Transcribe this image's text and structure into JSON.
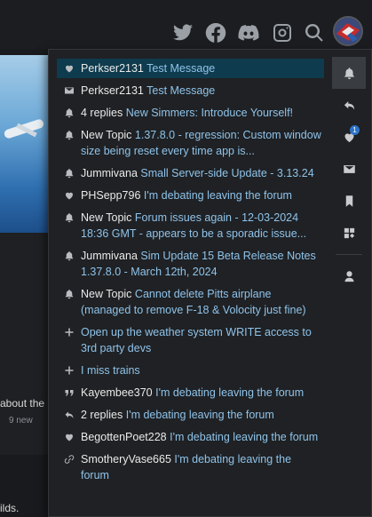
{
  "background": {
    "snippet": "about the",
    "meta": "9 new",
    "bottom_text": "ilds."
  },
  "header": {
    "icons": [
      "twitter-icon",
      "facebook-icon",
      "discord-icon",
      "instagram-icon",
      "search-icon"
    ]
  },
  "notifications": [
    {
      "icon": "heart-icon",
      "actor": "Perkser2131",
      "topic": "Test Message",
      "active": true
    },
    {
      "icon": "envelope-icon",
      "actor": "Perkser2131",
      "topic": "Test Message"
    },
    {
      "icon": "bell-icon",
      "actor": "4 replies",
      "topic": "New Simmers: Introduce Yourself!"
    },
    {
      "icon": "bell-icon",
      "actor": "New Topic",
      "topic": "1.37.8.0 - regression: Custom window size being reset every time app is..."
    },
    {
      "icon": "bell-icon",
      "actor": "Jummivana",
      "topic": "Small Server-side Update - 3.13.24"
    },
    {
      "icon": "heart-icon",
      "actor": "PHSepp796",
      "topic": "I'm debating leaving the forum"
    },
    {
      "icon": "bell-icon",
      "actor": "New Topic",
      "topic": "Forum issues again - 12-03-2024 18:36 GMT - appears to be a sporadic issue..."
    },
    {
      "icon": "bell-icon",
      "actor": "Jummivana",
      "topic": "Sim Update 15 Beta Release Notes 1.37.8.0 - March 12th, 2024"
    },
    {
      "icon": "bell-icon",
      "actor": "New Topic",
      "topic": "Cannot delete Pitts airplane (managed to remove F-18 & Volocity just fine)"
    },
    {
      "icon": "plus-icon",
      "actor": "",
      "topic": "Open up the weather system WRITE access to 3rd party devs"
    },
    {
      "icon": "plus-icon",
      "actor": "",
      "topic": "I miss trains"
    },
    {
      "icon": "quote-icon",
      "actor": "Kayembee370",
      "topic": "I'm debating leaving the forum"
    },
    {
      "icon": "reply-icon",
      "actor": "2 replies",
      "topic": "I'm debating leaving the forum"
    },
    {
      "icon": "heart-icon",
      "actor": "BegottenPoet228",
      "topic": "I'm debating leaving the forum"
    },
    {
      "icon": "link-icon",
      "actor": "SmotheryVase665",
      "topic": "I'm debating leaving the forum"
    }
  ],
  "rail": [
    {
      "icon": "bell-icon",
      "active": true
    },
    {
      "icon": "reply-icon"
    },
    {
      "icon": "heart-icon",
      "badge": "1"
    },
    {
      "icon": "envelope-icon"
    },
    {
      "icon": "bookmark-icon"
    },
    {
      "icon": "grid-icon"
    },
    {
      "icon": "user-icon",
      "separator_before": true
    }
  ],
  "colors": {
    "accent_link": "#8fc3ea",
    "active_row": "#0e3b4d",
    "badge": "#2d73c7"
  }
}
